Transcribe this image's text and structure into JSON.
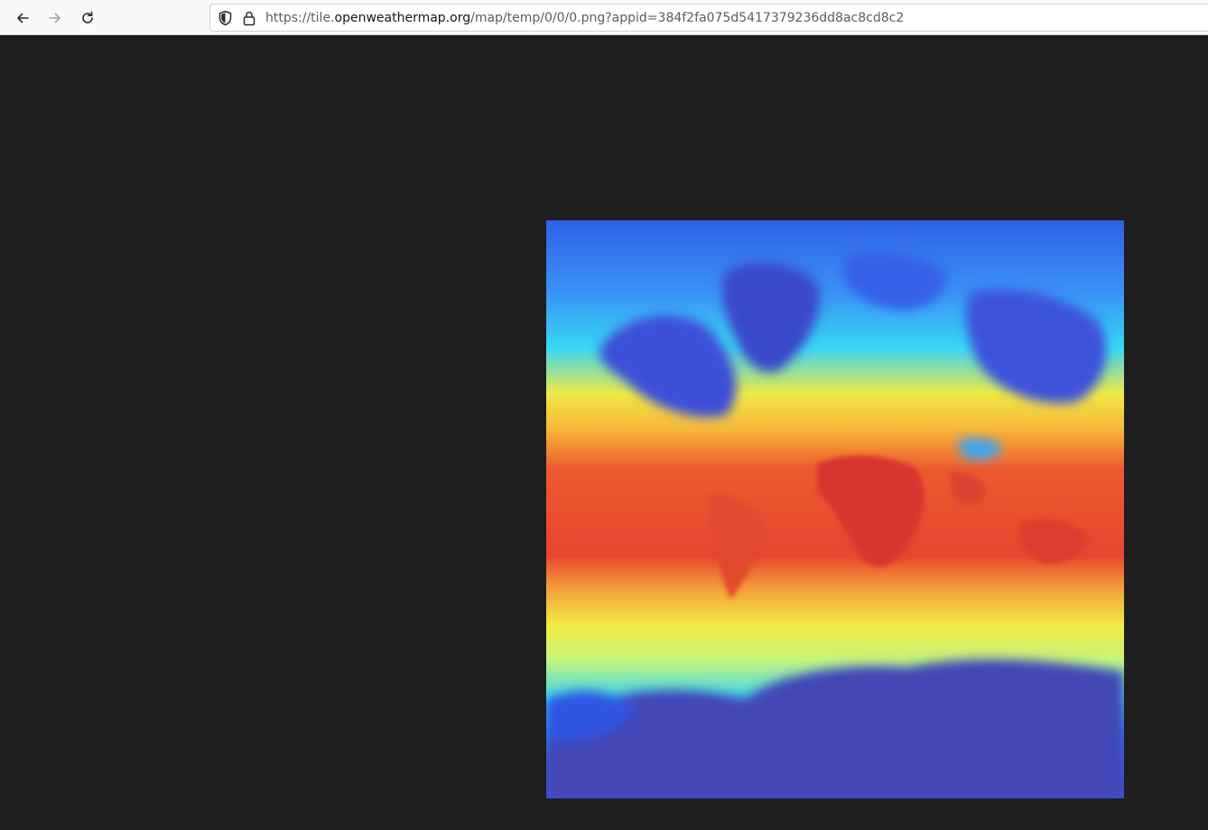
{
  "browser": {
    "nav": {
      "back_icon": "arrow-left-icon",
      "forward_icon": "arrow-right-icon",
      "reload_icon": "reload-icon"
    },
    "address_bar": {
      "security_icon": "shield-icon",
      "lock_icon": "lock-icon",
      "url_prefix": "https://tile.",
      "url_host": "openweathermap.org",
      "url_path": "/map/temp/0/0/0.png?appid=384f2fa075d5417379236dd8ac8cd8c2"
    }
  },
  "page": {
    "image_alt": "0.png",
    "image_content": "temperature-map-tile",
    "background_color": "#1e1e1e",
    "colors": {
      "cold": "#4347b5",
      "cool": "#2d6ef0",
      "cyan": "#38d6f5",
      "mild": "#c3f27a",
      "warm": "#f5e23c",
      "hot": "#e8452e",
      "hottest": "#d8302c"
    }
  }
}
